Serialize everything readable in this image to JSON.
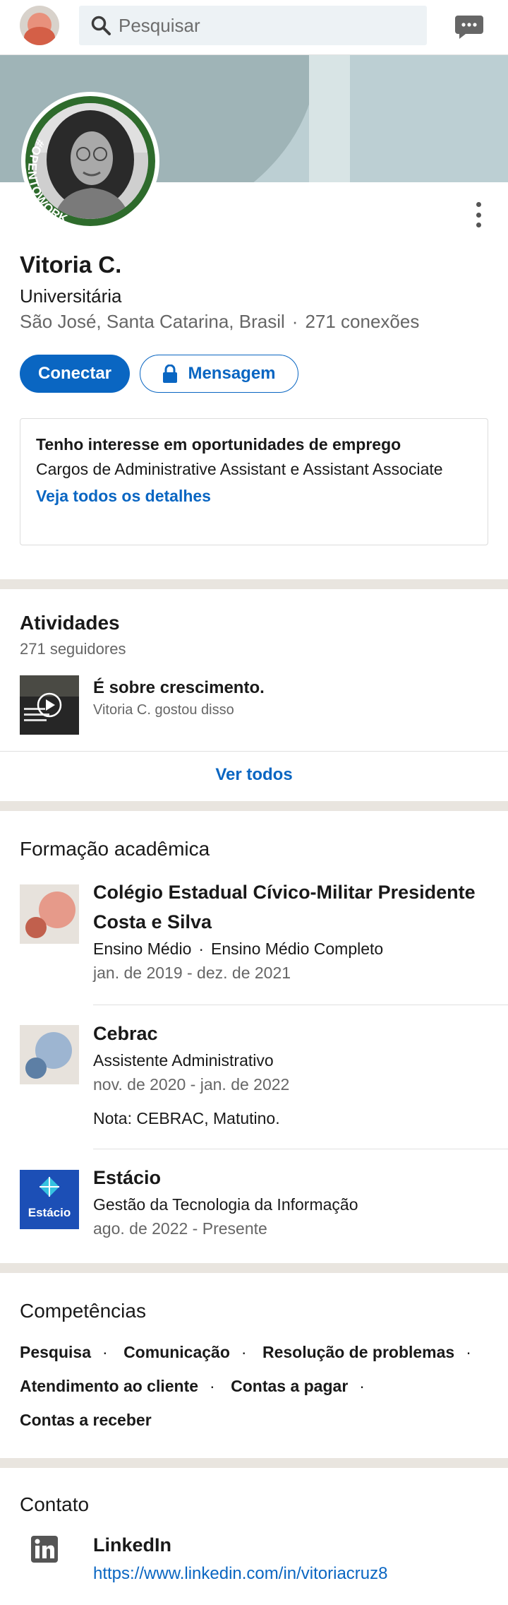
{
  "colors": {
    "accent": "#0a66c2",
    "separator": "#e9e5df",
    "open_to_work_green": "#2e6b2c"
  },
  "topbar": {
    "avatar_icon": "user-avatar",
    "search_icon": "search-icon",
    "search_placeholder": "Pesquisar",
    "messaging_icon": "chat-icon"
  },
  "profile": {
    "photo_badge": "#OPENTOWORK",
    "name": "Vitoria C.",
    "headline": "Universitária",
    "location": "São José, Santa Catarina, Brasil",
    "separator": "·",
    "connections": "271 conexões",
    "more_icon": "more-vertical-icon",
    "connect_label": "Conectar",
    "message_label": "Mensagem",
    "message_icon": "lock-icon"
  },
  "open_to_work": {
    "title": "Tenho interesse em oportunidades de emprego",
    "description": "Cargos de Administrative Assistant e Assistant Associate",
    "link": "Veja todos os detalhes"
  },
  "activity": {
    "title": "Atividades",
    "followers": "271 seguidores",
    "items": [
      {
        "title": "É sobre crescimento.",
        "subtitle": "Vitoria C. gostou disso",
        "thumb_icon": "play-icon"
      }
    ],
    "see_all": "Ver todos"
  },
  "education": {
    "title": "Formação acadêmica",
    "items": [
      {
        "name": "Colégio Estadual Cívico-Militar Presidente Costa e Silva",
        "degree": "Ensino Médio",
        "field": "Ensino Médio Completo",
        "dates": "jan. de 2019 - dez. de 2021"
      },
      {
        "name": "Cebrac",
        "degree": "Assistente Administrativo",
        "dates": "nov. de 2020 - jan. de 2022",
        "note": "Nota: CEBRAC, Matutino."
      },
      {
        "name": "Estácio",
        "logo_text": "Estácio",
        "degree": "Gestão da Tecnologia da Informação",
        "dates": "ago. de 2022 - Presente"
      }
    ]
  },
  "skills": {
    "title": "Competências",
    "items": [
      "Pesquisa",
      "Comunicação",
      "Resolução de problemas",
      "Atendimento ao cliente",
      "Contas a pagar",
      "Contas a receber"
    ]
  },
  "contact": {
    "title": "Contato",
    "icon": "linkedin-icon",
    "label": "LinkedIn",
    "url": "https://www.linkedin.com/in/vitoriacruz8"
  }
}
